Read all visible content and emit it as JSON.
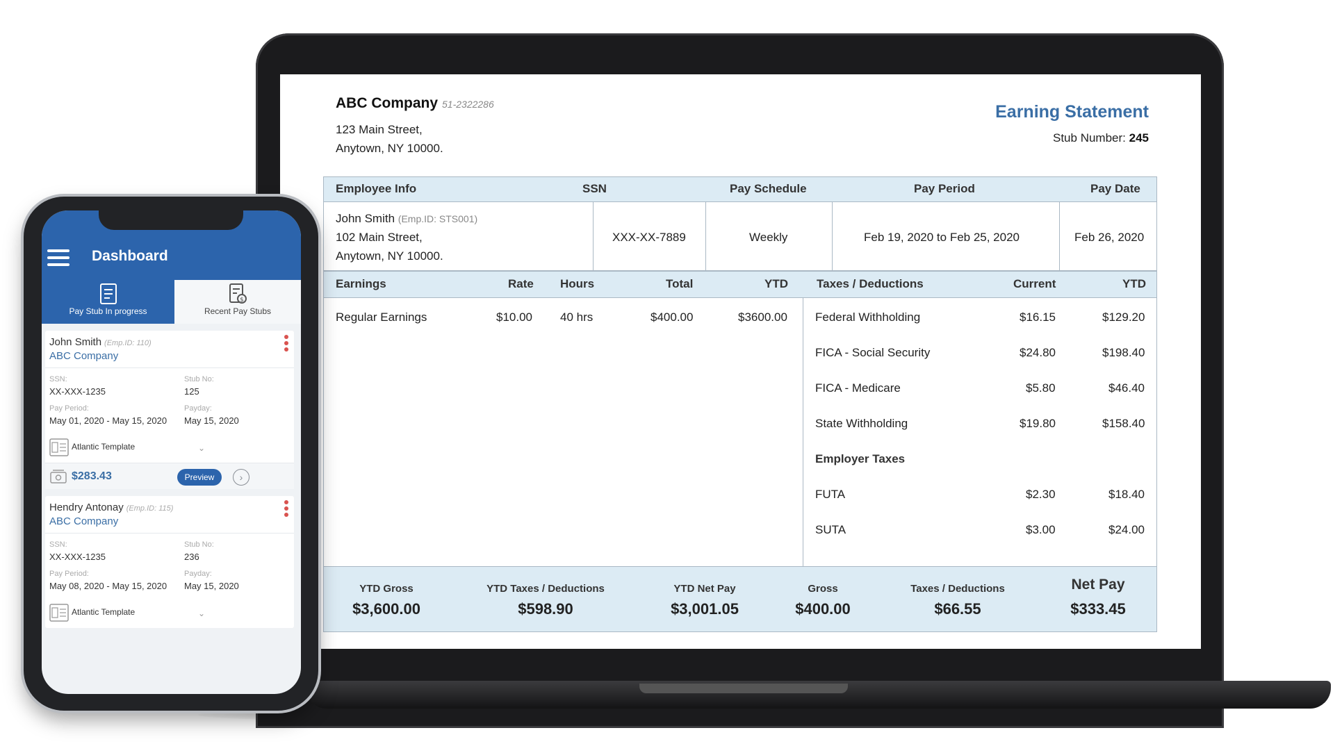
{
  "statement": {
    "company_name": "ABC Company",
    "company_id": "51-2322286",
    "address_line1": "123 Main Street,",
    "address_line2": "Anytown, NY 10000.",
    "title": "Earning Statement",
    "stub_label": "Stub Number:",
    "stub_number": "245",
    "info_headers": {
      "employee": "Employee Info",
      "ssn": "SSN",
      "schedule": "Pay Schedule",
      "period": "Pay Period",
      "date": "Pay Date"
    },
    "employee": {
      "name": "John Smith",
      "emp_id": "(Emp.ID: STS001)",
      "address_line1": "102 Main Street,",
      "address_line2": "Anytown, NY 10000.",
      "ssn": "XXX-XX-7889",
      "schedule": "Weekly",
      "period": "Feb 19, 2020 to Feb 25, 2020",
      "pay_date": "Feb 26, 2020"
    },
    "earnings_headers": {
      "earnings": "Earnings",
      "rate": "Rate",
      "hours": "Hours",
      "total": "Total",
      "ytd": "YTD"
    },
    "earnings": [
      {
        "name": "Regular Earnings",
        "rate": "$10.00",
        "hours": "40 hrs",
        "total": "$400.00",
        "ytd": "$3600.00"
      }
    ],
    "deductions_headers": {
      "name": "Taxes / Deductions",
      "current": "Current",
      "ytd": "YTD"
    },
    "deductions": [
      {
        "name": "Federal Withholding",
        "current": "$16.15",
        "ytd": "$129.20"
      },
      {
        "name": "FICA - Social Security",
        "current": "$24.80",
        "ytd": "$198.40"
      },
      {
        "name": "FICA - Medicare",
        "current": "$5.80",
        "ytd": "$46.40"
      },
      {
        "name": "State Withholding",
        "current": "$19.80",
        "ytd": "$158.40"
      }
    ],
    "employer_taxes_label": "Employer Taxes",
    "employer_taxes": [
      {
        "name": "FUTA",
        "current": "$2.30",
        "ytd": "$18.40"
      },
      {
        "name": "SUTA",
        "current": "$3.00",
        "ytd": "$24.00"
      }
    ],
    "summary": [
      {
        "label": "YTD Gross",
        "value": "$3,600.00"
      },
      {
        "label": "YTD Taxes / Deductions",
        "value": "$598.90"
      },
      {
        "label": "YTD Net Pay",
        "value": "$3,001.05"
      },
      {
        "label": "Gross",
        "value": "$400.00"
      },
      {
        "label": "Taxes / Deductions",
        "value": "$66.55"
      },
      {
        "label": "Net Pay",
        "value": "$333.45"
      }
    ]
  },
  "phone": {
    "title": "Dashboard",
    "tabs": [
      {
        "label": "Pay Stub In progress"
      },
      {
        "label": "Recent Pay Stubs"
      }
    ],
    "cards": [
      {
        "name": "John Smith",
        "emp_id": "(Emp.ID: 110)",
        "company": "ABC Company",
        "ssn_label": "SSN:",
        "ssn": "XX-XXX-1235",
        "stub_label": "Stub No:",
        "stub": "125",
        "period_label": "Pay Period:",
        "period": "May 01, 2020 - May 15, 2020",
        "payday_label": "Payday:",
        "payday": "May 15, 2020",
        "template": "Atlantic Template",
        "amount": "$283.43",
        "preview": "Preview"
      },
      {
        "name": "Hendry Antonay",
        "emp_id": "(Emp.ID: 115)",
        "company": "ABC Company",
        "ssn_label": "SSN:",
        "ssn": "XX-XXX-1235",
        "stub_label": "Stub No:",
        "stub": "236",
        "period_label": "Pay Period:",
        "period": "May 08, 2020 - May 15, 2020",
        "payday_label": "Payday:",
        "payday": "May 15, 2020",
        "template": "Atlantic Template"
      }
    ]
  },
  "colors": {
    "accent": "#2c64ac",
    "title_blue": "#3a6ea5",
    "header_bg": "#dcebf4",
    "menu_dots": "#d9534f"
  }
}
